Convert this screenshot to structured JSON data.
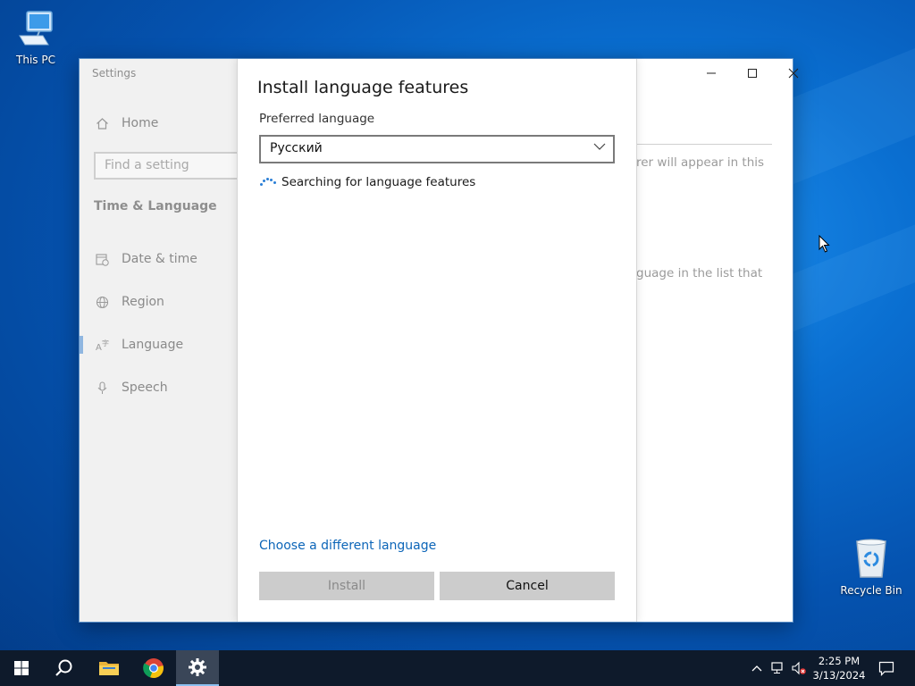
{
  "desktop": {
    "icons": [
      {
        "label": "This PC",
        "icon": "this-pc-icon"
      },
      {
        "label": "Recycle Bin",
        "icon": "recycle-bin-icon"
      }
    ]
  },
  "settings_window": {
    "app_title": "Settings",
    "search_placeholder": "Find a setting",
    "section": "Time & Language",
    "nav": [
      {
        "label": "Home",
        "icon": "home-icon"
      },
      {
        "label": "Date & time",
        "icon": "calendar-clock-icon"
      },
      {
        "label": "Region",
        "icon": "globe-icon"
      },
      {
        "label": "Language",
        "icon": "language-icon",
        "selected": true
      },
      {
        "label": "Speech",
        "icon": "microphone-icon"
      }
    ],
    "background_text": {
      "line1": "rer will appear in this",
      "line2": "guage in the list that"
    },
    "window_controls": [
      "minimize",
      "maximize",
      "close"
    ]
  },
  "dialog": {
    "title": "Install language features",
    "preferred_language_label": "Preferred language",
    "selected_language": "Русский",
    "status": "Searching for language features",
    "choose_link": "Choose a different language",
    "install_label": "Install",
    "cancel_label": "Cancel"
  },
  "taskbar": {
    "time": "2:25 PM",
    "date": "3/13/2024"
  },
  "colors": {
    "accent": "#0c65b8",
    "taskbar": "#0e1a2b",
    "button": "#cccccc"
  }
}
